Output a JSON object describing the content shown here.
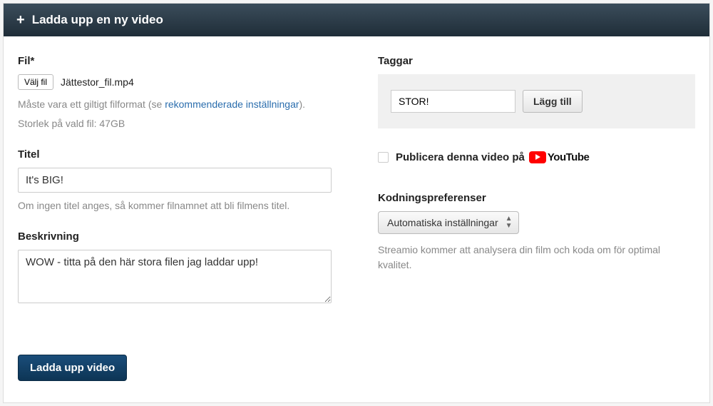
{
  "header": {
    "title": "Ladda upp en ny video"
  },
  "file": {
    "label": "Fil*",
    "choose_button": "Välj fil",
    "filename": "Jättestor_fil.mp4",
    "help_prefix": "Måste vara ett giltigt filformat (se ",
    "help_link": "rekommenderade inställningar",
    "help_suffix": ").",
    "size_text": "Storlek på vald fil: 47GB"
  },
  "title_field": {
    "label": "Titel",
    "value": "It's BIG!",
    "help": "Om ingen titel anges, så kommer filnamnet att bli filmens titel."
  },
  "description": {
    "label": "Beskrivning",
    "value": "WOW - titta på den här stora filen jag laddar upp!"
  },
  "tags": {
    "label": "Taggar",
    "input_value": "STOR!",
    "add_button": "Lägg till"
  },
  "publish": {
    "label": "Publicera denna video på",
    "platform": "YouTube"
  },
  "encoding": {
    "label": "Kodningspreferenser",
    "selected": "Automatiska inställningar",
    "help": "Streamio kommer att analysera din film och koda om för optimal kvalitet."
  },
  "submit": {
    "label": "Ladda upp video"
  }
}
